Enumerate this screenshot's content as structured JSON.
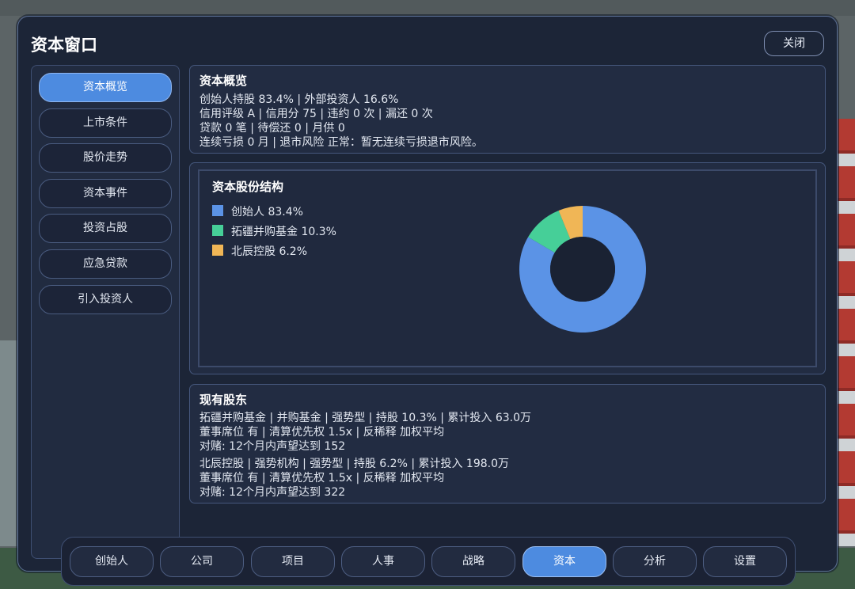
{
  "window": {
    "title": "资本窗口",
    "close_label": "关闭"
  },
  "sidebar": {
    "items": [
      {
        "label": "资本概览",
        "active": true
      },
      {
        "label": "上市条件",
        "active": false
      },
      {
        "label": "股价走势",
        "active": false
      },
      {
        "label": "资本事件",
        "active": false
      },
      {
        "label": "投资占股",
        "active": false
      },
      {
        "label": "应急贷款",
        "active": false
      },
      {
        "label": "引入投资人",
        "active": false
      }
    ]
  },
  "overview": {
    "title": "资本概览",
    "lines": [
      "创始人持股 83.4% | 外部投资人 16.6%",
      "信用评级 A | 信用分 75 | 违约 0 次 | 漏还 0 次",
      "贷款 0 笔 | 待偿还 0 | 月供 0",
      "连续亏损 0 月 | 退市风险 正常：暂无连续亏损退市风险。"
    ]
  },
  "chart_data": {
    "type": "pie",
    "title": "资本股份结构",
    "donut": true,
    "series": [
      {
        "name": "创始人",
        "value": 83.4,
        "color": "#5b93e6",
        "legend": "创始人 83.4%"
      },
      {
        "name": "拓疆并购基金",
        "value": 10.3,
        "color": "#46cf98",
        "legend": "拓疆并购基金 10.3%"
      },
      {
        "name": "北辰控股",
        "value": 6.2,
        "color": "#f0b656",
        "legend": "北辰控股 6.2%"
      }
    ]
  },
  "shareholders": {
    "title": "现有股东",
    "lines": [
      "拓疆并购基金 | 并购基金 | 强势型 | 持股 10.3% | 累计投入 63.0万",
      "董事席位 有 | 清算优先权 1.5x | 反稀释 加权平均",
      "对赌: 12个月内声望达到 152",
      "北辰控股 | 强势机构 | 强势型 | 持股 6.2% | 累计投入 198.0万",
      "董事席位 有 | 清算优先权 1.5x | 反稀释 加权平均",
      "对赌: 12个月内声望达到 322"
    ]
  },
  "bottom_tabs": [
    {
      "label": "创始人",
      "active": false
    },
    {
      "label": "公司",
      "active": false
    },
    {
      "label": "项目",
      "active": false
    },
    {
      "label": "人事",
      "active": false
    },
    {
      "label": "战略",
      "active": false
    },
    {
      "label": "资本",
      "active": true
    },
    {
      "label": "分析",
      "active": false
    },
    {
      "label": "设置",
      "active": false
    }
  ]
}
